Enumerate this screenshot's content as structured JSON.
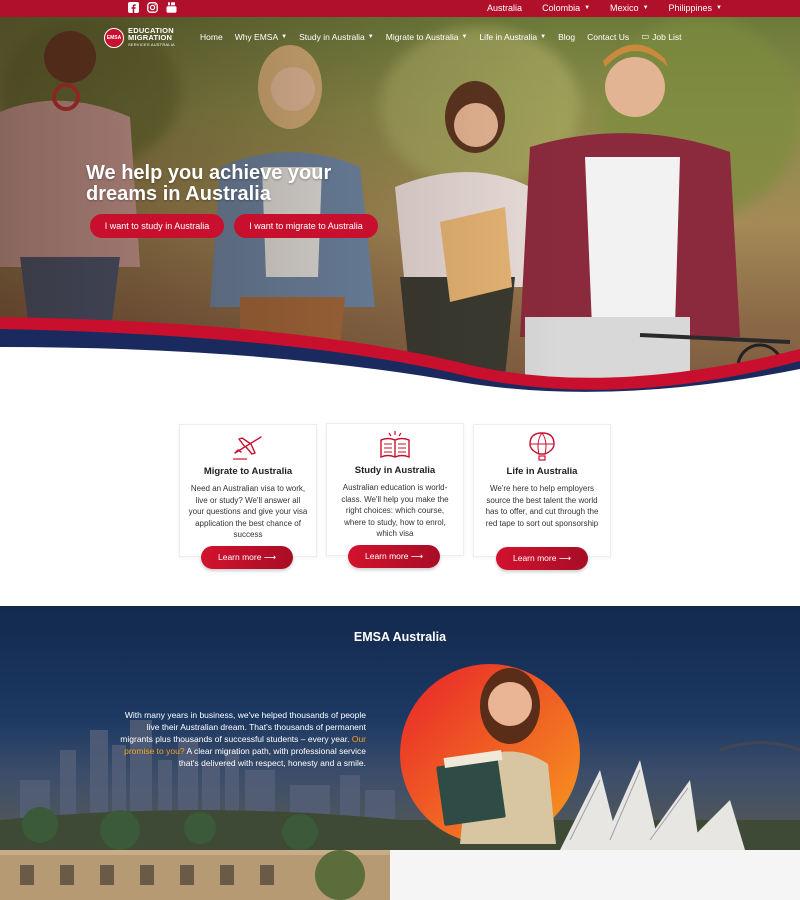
{
  "topbar": {
    "socials": [
      "facebook-icon",
      "instagram-icon",
      "youtube-icon"
    ],
    "countries": [
      {
        "label": "Australia",
        "has_dropdown": false
      },
      {
        "label": "Colombia",
        "has_dropdown": true
      },
      {
        "label": "Mexico",
        "has_dropdown": true
      },
      {
        "label": "Philippines",
        "has_dropdown": true
      }
    ]
  },
  "logo": {
    "badge": "EMSA",
    "line1": "EDUCATION",
    "line2": "MIGRATION",
    "line3": "SERVICES AUSTRALIA"
  },
  "nav": {
    "items": [
      {
        "label": "Home",
        "dropdown": false
      },
      {
        "label": "Why EMSA",
        "dropdown": true
      },
      {
        "label": "Study in Australia",
        "dropdown": true
      },
      {
        "label": "Migrate to Australia",
        "dropdown": true
      },
      {
        "label": "Life in Australia",
        "dropdown": true
      },
      {
        "label": "Blog",
        "dropdown": false
      },
      {
        "label": "Contact Us",
        "dropdown": false
      },
      {
        "label": "Job List",
        "dropdown": false
      }
    ]
  },
  "hero": {
    "title": "We help you achieve your dreams in Australia",
    "btn_study": "I want to study in Australia",
    "btn_migrate": "I want to migrate to Australia"
  },
  "cards": [
    {
      "icon": "airplane-icon",
      "title": "Migrate to Australia",
      "text": "Need an Australian visa to work, live or study? We'll answer all your questions and give your visa application the best chance of success",
      "button": "Learn more ⟶"
    },
    {
      "icon": "open-book-icon",
      "title": "Study in Australia",
      "text": "Australian education is world-class. We'll help you make the right choices: which course, where to study, how to enrol, which visa",
      "button": "Learn more ⟶"
    },
    {
      "icon": "hot-air-balloon-icon",
      "title": "Life in Australia",
      "text": "We're here to help employers source the best talent the world has to offer, and cut through the red tape to sort out sponsorship",
      "button": "Learn more ⟶"
    }
  ],
  "about": {
    "title": "EMSA Australia",
    "text": "With many years in business, we've helped thousands of people live their Australian dream. That's thousands of permanent migrants plus thousands of successful students – every year.",
    "promise_label": "Our promise to you?",
    "promise_text": " A clear migration path, with professional service that's delivered with respect, honesty and a smile."
  },
  "colors": {
    "brand_red": "#c8102e",
    "navy": "#13294e",
    "accent_orange": "#f6a21d"
  }
}
